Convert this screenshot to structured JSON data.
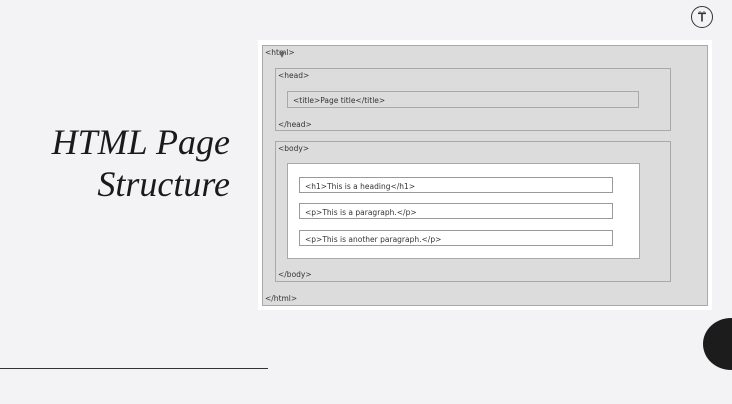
{
  "slide": {
    "title_line1": "HTML Page",
    "title_line2": "Structure"
  },
  "toolbar": {
    "text_tool_glyph": "T"
  },
  "diagram": {
    "html_open": "<html>",
    "head_open": "<head>",
    "title_element": "<title>Page title</title>",
    "head_close": "</head>",
    "body_open": "<body>",
    "h1_element": "<h1>This is a heading</h1>",
    "p1_element": "<p>This is a paragraph.</p>",
    "p2_element": "<p>This is another paragraph.</p>",
    "body_close": "</body>",
    "html_close": "</html>"
  },
  "colors": {
    "background": "#f3f3f5",
    "container_fill": "#dcdcdc",
    "element_fill": "#ffffff",
    "text": "#1a1a1a"
  },
  "icons": [
    "text-tool-icon",
    "cursor-icon"
  ]
}
